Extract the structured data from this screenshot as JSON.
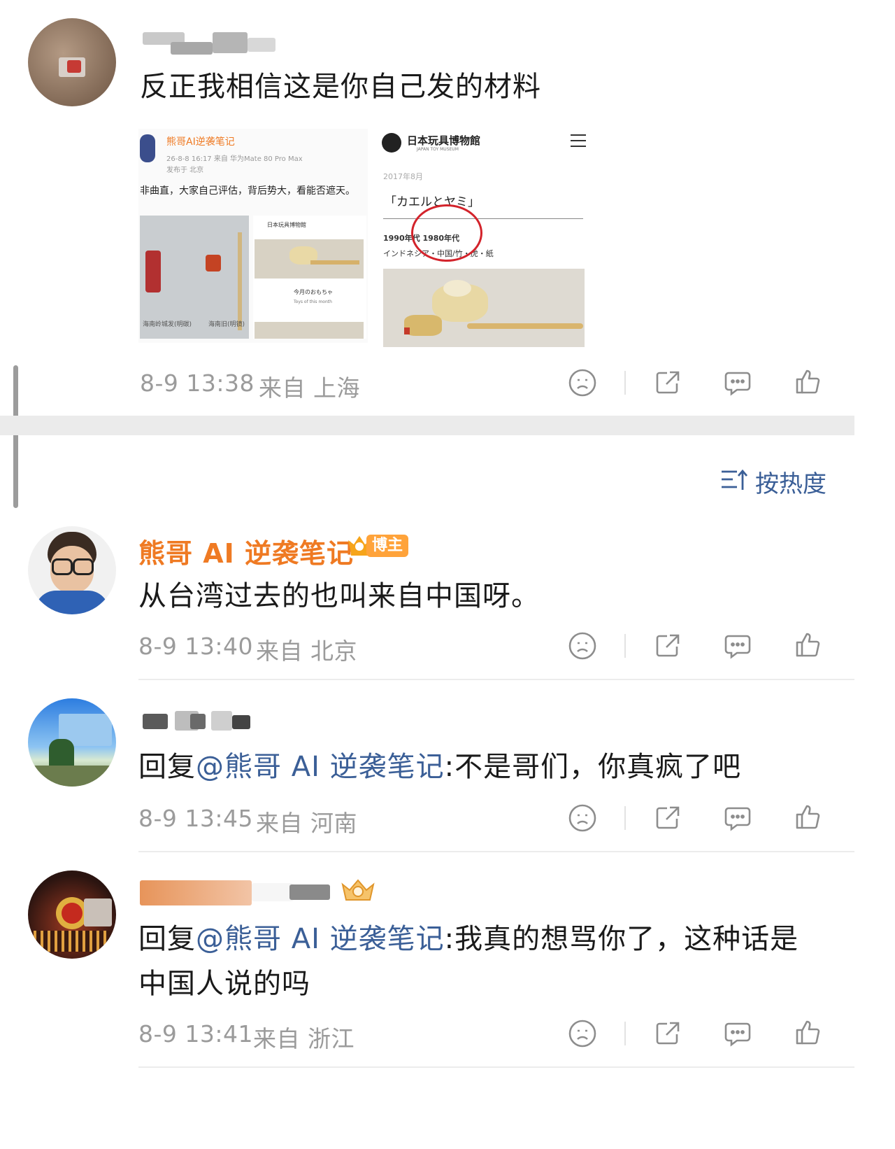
{
  "first_comment": {
    "text": "反正我相信这是你自己发的材料",
    "time": "8-9 13:38",
    "location": "来自 上海",
    "attachment_1": {
      "author": "熊哥AI逆袭笔记",
      "meta": "26-8-8 16:17  来自 华为Mate 80 Pro Max",
      "meta2": "发布于 北京",
      "text": "非曲直，大家自己评估，背后势大，看能否遮天。",
      "inner_caption": "今月のおもちゃ",
      "inner_caption2": "Toys of this month",
      "museum": "日本玩具博物館",
      "photo_label_left": "海南岭城发(明碳)",
      "photo_label_right": "海南旧(明镜)"
    },
    "attachment_2": {
      "museum": "日本玩具博物館",
      "museum_en": "JAPAN TOY MUSEUM",
      "date": "2017年8月",
      "title": "「カエルとヤミ」",
      "era": "1990年代 1980年代",
      "origin": "インドネシア・中国/竹・虎・紙"
    }
  },
  "sort": {
    "label": "按热度"
  },
  "comments": [
    {
      "name": "熊哥 AI 逆袭笔记",
      "badge": "博主",
      "text": "从台湾过去的也叫来自中国呀。",
      "time": "8-9 13:40",
      "location": "来自 北京"
    },
    {
      "name": "",
      "reply_prefix": "回复",
      "mention": "@熊哥 AI 逆袭笔记",
      "text": ":不是哥们，你真疯了吧",
      "time": "8-9 13:45",
      "location": "来自 河南"
    },
    {
      "name": "",
      "reply_prefix": "回复",
      "mention": "@熊哥 AI 逆袭笔记",
      "text": ":我真的想骂你了，这种话是",
      "text2": "中国人说的吗",
      "time": "8-9 13:41",
      "location": "来自 浙江"
    }
  ],
  "colors": {
    "accent": "#ef7a23",
    "mention": "#3b5f97",
    "meta": "#9b9b9b",
    "badge": "#ffa33a"
  },
  "icons": [
    "sad-face-icon",
    "share-icon",
    "comment-icon",
    "like-icon",
    "sort-icon",
    "crown-icon"
  ]
}
